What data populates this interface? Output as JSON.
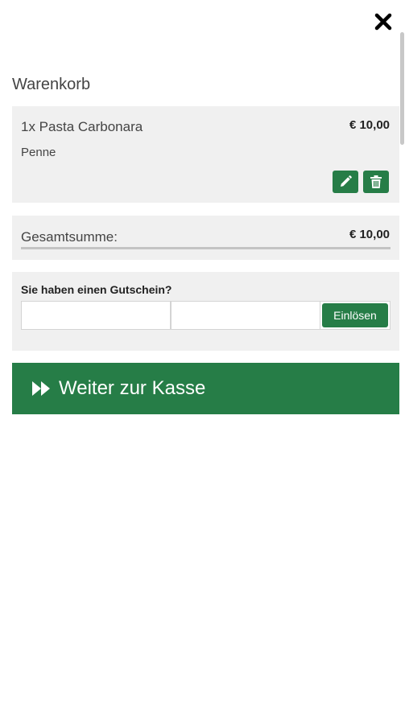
{
  "header": {
    "title": "Warenkorb"
  },
  "cart": {
    "items": [
      {
        "quantity_name": "1x Pasta Carbonara",
        "option": "Penne",
        "price": "€ 10,00"
      }
    ]
  },
  "total": {
    "label": "Gesamtsumme:",
    "value": "€ 10,00"
  },
  "voucher": {
    "label": "Sie haben einen Gutschein?",
    "input1_value": "",
    "input2_value": "",
    "redeem_label": "Einlösen"
  },
  "checkout": {
    "label": "Weiter zur Kasse"
  },
  "colors": {
    "accent": "#267d47",
    "panel": "#f0f0f0"
  },
  "icons": {
    "close": "close-icon",
    "edit": "pencil-icon",
    "delete": "trash-icon",
    "checkout": "fast-forward-icon"
  }
}
